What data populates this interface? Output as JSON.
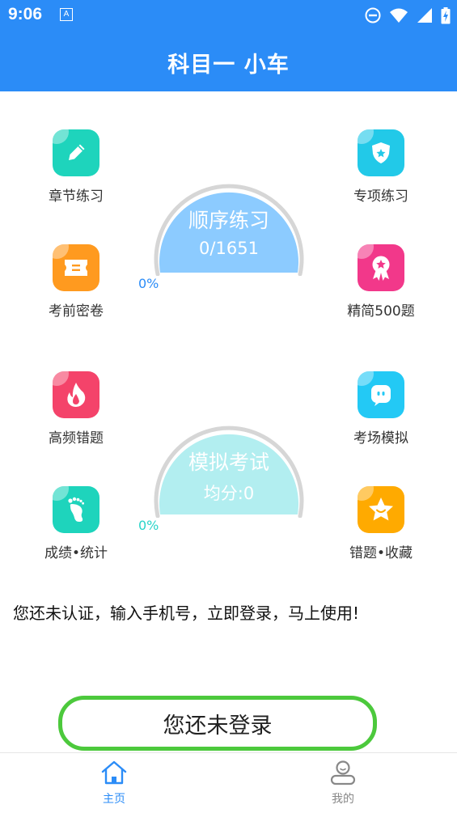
{
  "status_bar": {
    "time": "9:06",
    "notification_letter": "A"
  },
  "header": {
    "title": "科目一 小车"
  },
  "features_top": {
    "chapter": {
      "label": "章节练习",
      "icon": "pencil-icon",
      "color": "#1ed4bc"
    },
    "special": {
      "label": "专项练习",
      "icon": "shield-icon",
      "color": "#22c9e8"
    },
    "mock_paper": {
      "label": "考前密卷",
      "icon": "ticket-icon",
      "color": "#ff9a1f"
    },
    "selected500": {
      "label": "精简500题",
      "icon": "award-icon",
      "color": "#f2388a"
    }
  },
  "practice_gauge": {
    "title": "顺序练习",
    "progress_text": "0/1651",
    "percent_text": "0%",
    "percent": 0,
    "color": "#8ccbff",
    "percent_color": "#2b8cf7"
  },
  "features_bottom": {
    "wrong_frequent": {
      "label": "高频错题",
      "icon": "flame-icon",
      "color": "#f4436a"
    },
    "exam_sim": {
      "label": "考场模拟",
      "icon": "chat-face-icon",
      "color": "#23c9f5"
    },
    "stats": {
      "label": "成绩•统计",
      "icon": "footprint-icon",
      "color": "#1ed4bc"
    },
    "favorites": {
      "label": "错题•收藏",
      "icon": "star-icon",
      "color": "#ffaa00"
    }
  },
  "exam_gauge": {
    "title": "模拟考试",
    "score_text": "均分:0",
    "percent_text": "0%",
    "percent": 0,
    "color": "#b2eef0",
    "percent_color": "#2ad4c9"
  },
  "notice": "您还未认证，输入手机号，立即登录，马上使用!",
  "login_button": {
    "label": "您还未登录",
    "border_color": "#4cc93c"
  },
  "bottom_nav": {
    "home": {
      "label": "主页",
      "icon": "home-icon",
      "active": true,
      "color": "#2b8cf7"
    },
    "mine": {
      "label": "我的",
      "icon": "user-icon",
      "active": false,
      "color": "#888888"
    }
  }
}
